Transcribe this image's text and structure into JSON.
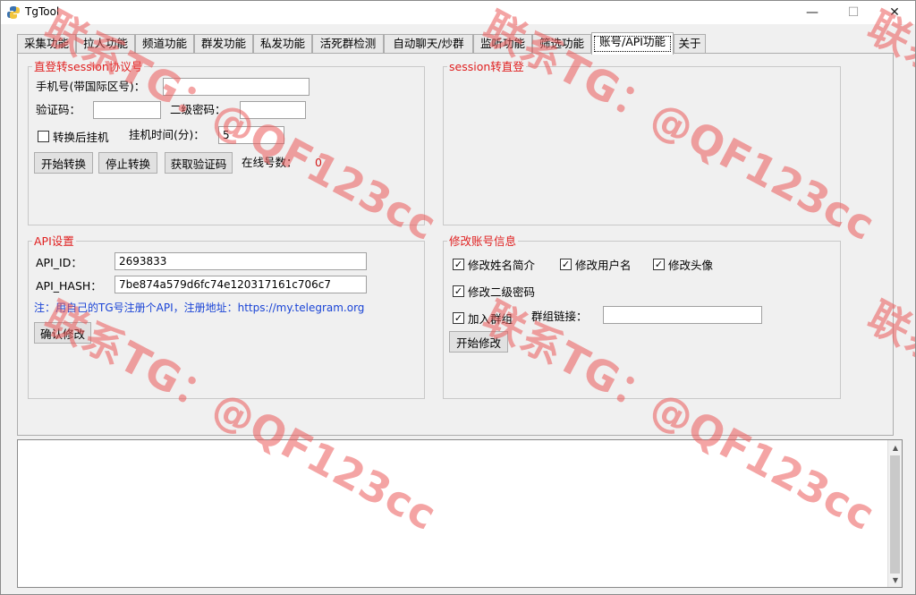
{
  "window": {
    "title": "TgTool",
    "minimize": "—",
    "maximize": "☐",
    "close": "✕"
  },
  "tabs": [
    {
      "label": "采集功能"
    },
    {
      "label": "拉人功能"
    },
    {
      "label": "频道功能"
    },
    {
      "label": "群发功能"
    },
    {
      "label": "私发功能"
    },
    {
      "label": "活死群检测"
    },
    {
      "label": "自动聊天/炒群"
    },
    {
      "label": "监听功能"
    },
    {
      "label": "筛选功能"
    },
    {
      "label": "账号/API功能"
    },
    {
      "label": "关于"
    }
  ],
  "login_group": {
    "title": "直登转session协议号",
    "phone_label": "手机号(带国际区号)：",
    "phone_value": "",
    "code_label": "验证码：",
    "code_value": "",
    "password2_label": "二级密码：",
    "password2_value": "",
    "hang_after_convert": "转换后挂机",
    "hang_time_label": "挂机时间(分)：",
    "hang_time_value": "5",
    "start_btn": "开始转换",
    "stop_btn": "停止转换",
    "get_code_btn": "获取验证码",
    "online_label": "在线号数：",
    "online_count": "0"
  },
  "session_group": {
    "title": "session转直登"
  },
  "api_group": {
    "title": "API设置",
    "api_id_label": "API_ID：",
    "api_id_value": "2693833",
    "api_hash_label": "API_HASH：",
    "api_hash_value": "7be874a579d6fc74e120317161c706c7",
    "note": "注：用自己的TG号注册个API，注册地址：https://my.telegram.org",
    "confirm_btn": "确认修改"
  },
  "modify_group": {
    "title": "修改账号信息",
    "opt_name_bio": "修改姓名简介",
    "opt_username": "修改用户名",
    "opt_avatar": "修改头像",
    "opt_password2": "修改二级密码",
    "opt_join_group": "加入群组",
    "group_link_label": "群组链接：",
    "group_link_value": "",
    "start_btn": "开始修改"
  },
  "watermark": "联系TG：@QF123cc",
  "colors": {
    "group_title": "#e02020",
    "note": "#1a44d6",
    "online_count": "#d31a1a"
  }
}
